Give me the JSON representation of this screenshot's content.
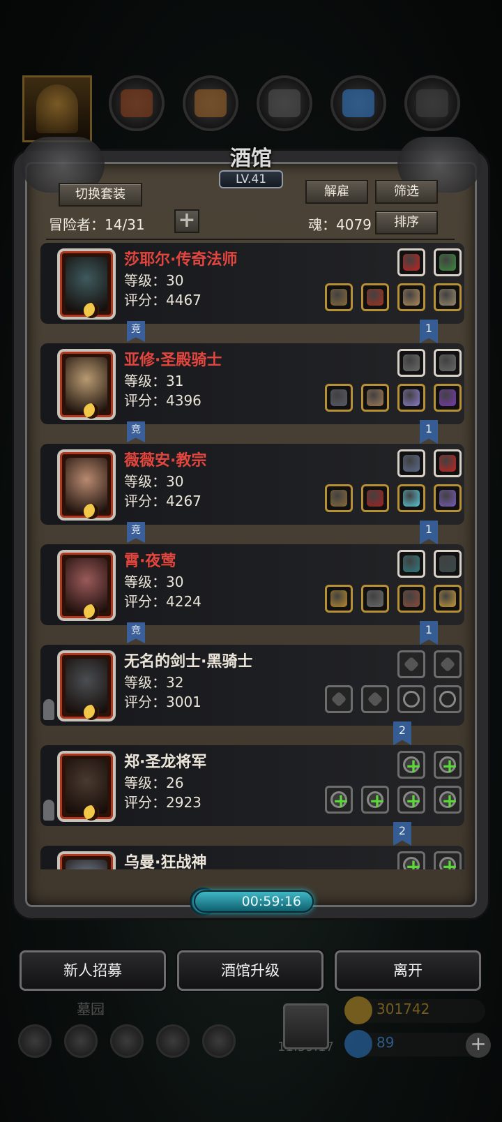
{
  "top_resources": [
    {
      "icon": "adventurer-helmet-icon",
      "selected": true
    },
    {
      "icon": "leather-icon"
    },
    {
      "icon": "wood-plank-icon"
    },
    {
      "icon": "iron-ingot-icon"
    },
    {
      "icon": "blue-crystal-icon"
    },
    {
      "icon": "dark-ore-icon"
    }
  ],
  "tavern": {
    "title": "酒馆",
    "level": "LV.41",
    "switch_outfit_label": "切换套装",
    "dismiss_label": "解雇",
    "filter_label": "筛选",
    "sort_label": "排序",
    "adventurer_count": "冒险者：14/31",
    "soul": "魂：4079",
    "add_icon": "plus-icon"
  },
  "labels": {
    "compete_tag": "竞"
  },
  "heroes": [
    {
      "name": "莎耶尔·传奇法师",
      "name_color": "#e2463e",
      "level": "等级：30",
      "score": "评分：4467",
      "compete": true,
      "team": "1",
      "resting": false,
      "face_color": "#3e5a5e",
      "top_slots": [
        {
          "icon": "red-gem-icon",
          "color": "#c0241f",
          "frame": "white"
        },
        {
          "icon": "green-rune-icon",
          "color": "#3d8a3d",
          "frame": "white"
        }
      ],
      "bottom_slots": [
        {
          "icon": "staff-icon",
          "color": "#8a6a3a",
          "frame": "gold"
        },
        {
          "icon": "red-robe-icon",
          "color": "#a3311f",
          "frame": "gold"
        },
        {
          "icon": "mask-icon",
          "color": "#b08a5a",
          "frame": "gold"
        },
        {
          "icon": "amulet-icon",
          "color": "#9a8a6a",
          "frame": "gold"
        }
      ]
    },
    {
      "name": "亚修·圣殿骑士",
      "name_color": "#e2463e",
      "level": "等级：31",
      "score": "评分：4396",
      "compete": true,
      "team": "1",
      "resting": false,
      "face_color": "#b89a72",
      "top_slots": [
        {
          "icon": "crossbow-icon",
          "color": "#6a6a6a",
          "frame": "white"
        },
        {
          "icon": "crossbow-icon",
          "color": "#6a6a6a",
          "frame": "white"
        }
      ],
      "bottom_slots": [
        {
          "icon": "war-hammer-icon",
          "color": "#5a5a6a",
          "frame": "gold"
        },
        {
          "icon": "breastplate-icon",
          "color": "#a07a56",
          "frame": "gold"
        },
        {
          "icon": "potion-icon",
          "color": "#8a7ac8",
          "frame": "gold"
        },
        {
          "icon": "magic-wand-icon",
          "color": "#7a3ab0",
          "frame": "gold"
        }
      ]
    },
    {
      "name": "薇薇安·教宗",
      "name_color": "#e2463e",
      "level": "等级：30",
      "score": "评分：4267",
      "compete": true,
      "team": "1",
      "resting": false,
      "face_color": "#b88a70",
      "top_slots": [
        {
          "icon": "necklace-icon",
          "color": "#5a6a8a",
          "frame": "white"
        },
        {
          "icon": "red-gem-icon",
          "color": "#c0241f",
          "frame": "white"
        }
      ],
      "bottom_slots": [
        {
          "icon": "mace-icon",
          "color": "#8a6a3a",
          "frame": "gold"
        },
        {
          "icon": "red-cloak-icon",
          "color": "#a3211f",
          "frame": "gold"
        },
        {
          "icon": "ice-orb-icon",
          "color": "#5ac8d8",
          "frame": "gold"
        },
        {
          "icon": "ring-icon",
          "color": "#7a5ab8",
          "frame": "gold"
        }
      ]
    },
    {
      "name": "霄·夜莺",
      "name_color": "#e2463e",
      "level": "等级：30",
      "score": "评分：4224",
      "compete": true,
      "team": "1",
      "resting": false,
      "face_color": "#9a5a5a",
      "top_slots": [
        {
          "icon": "teal-gem-icon",
          "color": "#2f7a7e",
          "frame": "white"
        },
        {
          "icon": "dark-gem-icon",
          "color": "#3a4a4a",
          "frame": "white"
        }
      ],
      "bottom_slots": [
        {
          "icon": "scepter-icon",
          "color": "#b88a2a",
          "frame": "gold"
        },
        {
          "icon": "spiked-armor-icon",
          "color": "#6a6a6a",
          "frame": "gold"
        },
        {
          "icon": "bracer-icon",
          "color": "#8a4a3a",
          "frame": "gold"
        },
        {
          "icon": "gold-ring-icon",
          "color": "#c89a3a",
          "frame": "gold"
        }
      ]
    },
    {
      "name": "无名的剑士·黑骑士",
      "name_color": "#ece6da",
      "level": "等级：32",
      "score": "评分：3001",
      "compete": false,
      "team": "2",
      "resting": true,
      "face_color": "#4a4e52",
      "top_slots": [
        {
          "icon": "hourglass-icon",
          "frame": "gray-square"
        },
        {
          "icon": "hourglass-icon",
          "frame": "gray-square"
        }
      ],
      "bottom_slots": [
        {
          "icon": "sword-slot-icon",
          "frame": "gray-square"
        },
        {
          "icon": "armor-slot-icon",
          "frame": "gray-square"
        },
        {
          "icon": "ring-slot-icon",
          "frame": "gray"
        },
        {
          "icon": "ring-slot-icon",
          "frame": "gray"
        }
      ]
    },
    {
      "name": "郑·圣龙将军",
      "name_color": "#ece6da",
      "level": "等级：26",
      "score": "评分：2923",
      "compete": false,
      "team": "2",
      "resting": true,
      "face_color": "#4a3a30",
      "top_slots": [
        {
          "icon": "add-gear-icon",
          "frame": "green"
        },
        {
          "icon": "add-gear-icon",
          "frame": "green"
        }
      ],
      "bottom_slots": [
        {
          "icon": "add-weapon-icon",
          "frame": "green"
        },
        {
          "icon": "add-armor-icon",
          "frame": "green"
        },
        {
          "icon": "add-ring-icon",
          "frame": "green"
        },
        {
          "icon": "add-ring-icon",
          "frame": "green"
        }
      ]
    },
    {
      "name": "乌曼·狂战神",
      "name_color": "#ece6da",
      "level": "",
      "score": "",
      "compete": false,
      "team": "",
      "resting": false,
      "face_color": "#7a8a9a",
      "top_slots": [
        {
          "icon": "add-gear-icon",
          "frame": "green"
        },
        {
          "icon": "add-gear-icon",
          "frame": "green"
        }
      ],
      "bottom_slots": []
    }
  ],
  "timer": "00:59:16",
  "actions": {
    "recruit_label": "新人招募",
    "upgrade_label": "酒馆升级",
    "leave_label": "离开"
  },
  "background": {
    "area_name": "墓园",
    "gift_timer": "11:59:17",
    "gold": "301742",
    "gems": "89"
  }
}
